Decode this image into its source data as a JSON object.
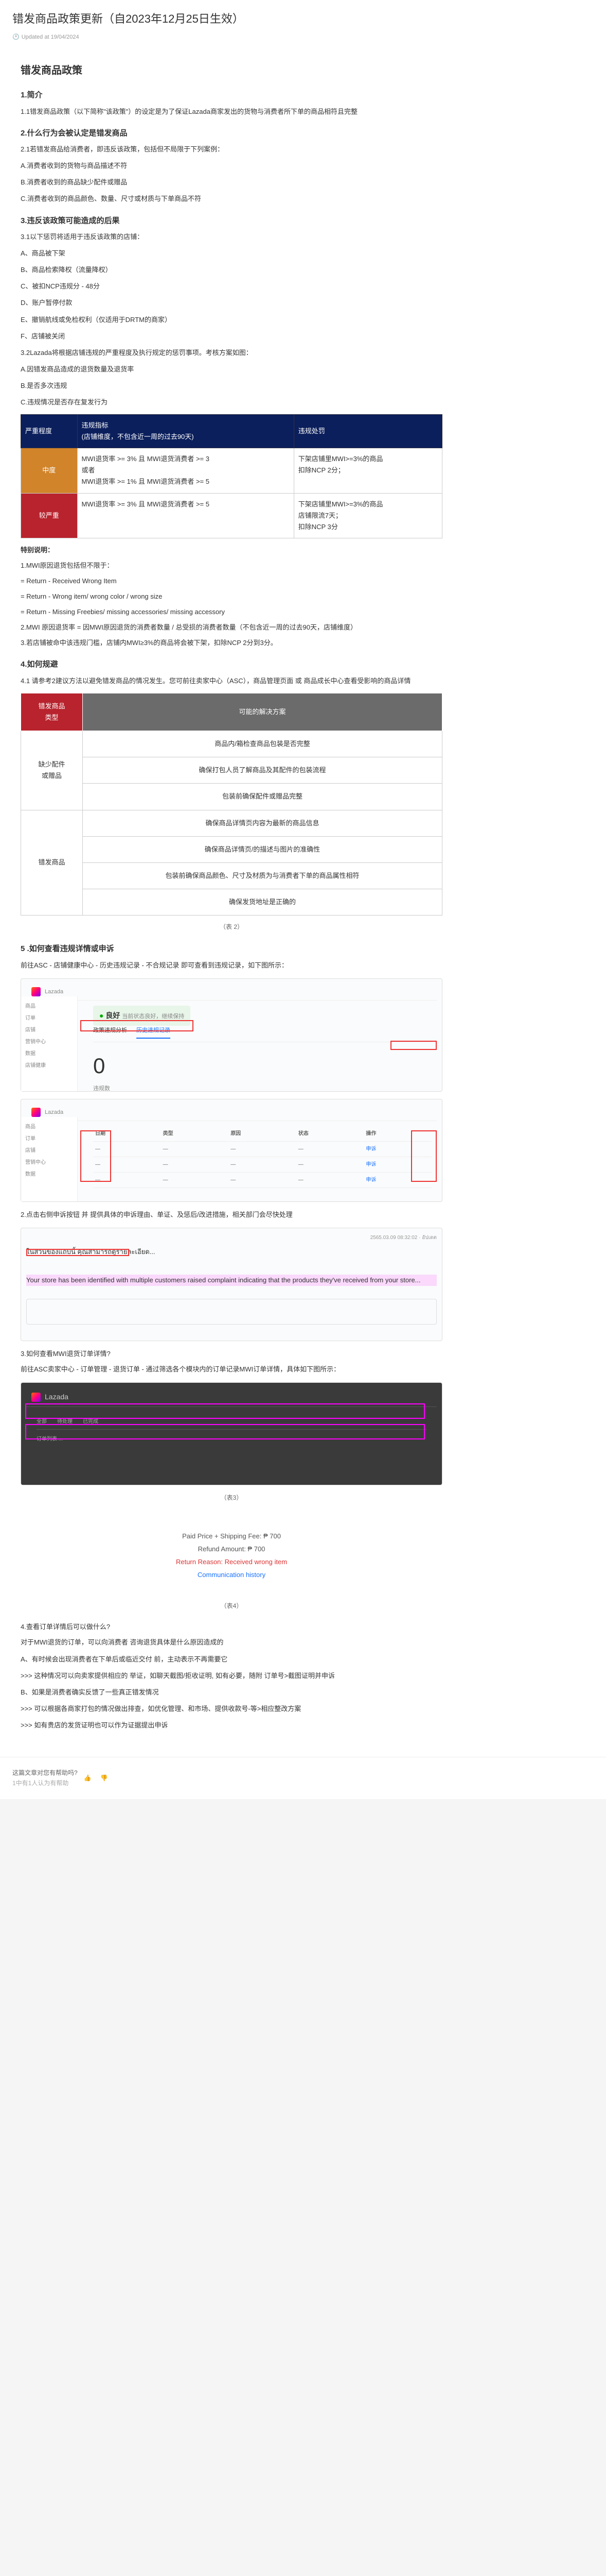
{
  "page_title": "错发商品政策更新（自2023年12月25日生效）",
  "updated_label": "Updated at 19/04/2024",
  "h_policy": "错发商品政策",
  "s1_h": "1.简介",
  "s1_p": "1.1错发商品政策（以下简称\"该政策\"）的设定是为了保证Lazada商家发出的货物与消费者所下单的商品相符且完整",
  "s2_h": "2.什么行为会被认定是错发商品",
  "s2_1": "2.1若错发商品给消费者，即违反该政策，包括但不局限于下列案例：",
  "s2_a": "A.消费者收到的货物与商品描述不符",
  "s2_b": "B.消费者收到的商品缺少配件或赠品",
  "s2_c": "C.消费者收到的商品颜色、数量、尺寸或材质与下单商品不符",
  "s3_h": "3.违反该政策可能造成的后果",
  "s3_1": "3.1以下惩罚将适用于违反该政策的店铺：",
  "s3_a": "A、商品被下架",
  "s3_b": "B、商品检索降权（流量降权）",
  "s3_c": "C、被扣NCP违规分 - 48分",
  "s3_d": "D、账户暂停付款",
  "s3_e": "E、撤销航线或免检权利（仅适用于DRTM的商家）",
  "s3_f": "F、店铺被关闭",
  "s3_2": "3.2Lazada将根据店铺违规的严重程度及执行规定的惩罚事项。考核方案如图：",
  "s3_2a": "A.因错发商品造成的退货数量及退货率",
  "s3_2b": "B.是否多次违规",
  "s3_2c": "C.违规情况是否存在复发行为",
  "t1_h1": "严重程度",
  "t1_h2": "违规指标\n(店铺维度，不包含近一周的过去90天)",
  "t1_h3": "违规处罚",
  "t1_mid": "中度",
  "t1_mid_rule": "MWI退货率 >= 3% 且 MWI退货消费者 >= 3\n或者\nMWI退货率 >= 1% 且 MWI退货消费者 >= 5",
  "t1_mid_pun": "下架店铺里MWI>=3%的商品\n扣除NCP 2分；",
  "t1_high": "较严重",
  "t1_high_rule": "MWI退货率 >= 3% 且 MWI退货消费者 >= 5",
  "t1_high_pun": "下架店铺里MWI>=3%的商品\n店铺限流7天；\n扣除NCP 3分",
  "note_h": "特别说明：",
  "note_1": "1.MWI原因退货包括但不限于：",
  "note_a": "= Return - Received Wrong Item",
  "note_b": "= Return - Wrong item/ wrong color / wrong size",
  "note_c": "= Return - Missing Freebies/ missing accessories/ missing accessory",
  "note_2": "2.MWI 原因退货率 = 因MWI原因退货的消费者数量 / 总受损的消费者数量（不包含近一周的过去90天，店铺维度）",
  "note_3": "3.若店铺被命中该违规门槛，店铺内MWI≥3%的商品将会被下架，扣除NCP 2分到3分。",
  "s4_h": "4.如何规避",
  "s4_1": "4.1 请参考2建议方法以避免错发商品的情况发生。您可前往卖家中心（ASC），商品管理页面 或 商品成长中心查看受影响的商品详情",
  "t2_h1": "错发商品\n类型",
  "t2_h2": "可能的解决方案",
  "t2_r1a": "商品内/箱检查商品包装是否完整",
  "t2_r1h": "缺少配件\n或赠品",
  "t2_r1b": "确保打包人员了解商品及其配件的包装流程",
  "t2_r1c": "包装前确保配件或赠品完整",
  "t2_r2a": "确保商品详情页内容为最新的商品信息",
  "t2_r2h": "错发商品",
  "t2_r2b": "确保商品详情页/的描述与图片的准确性",
  "t2_r2c": "包装前确保商品颜色、尺寸及材质为与消费者下单的商品属性相符",
  "t2_r2d": "确保发货地址是正确的",
  "cap2": "（表 2）",
  "s5_h": "5 .如何查看违规详情或申诉",
  "s5_1": "前往ASC - 店铺健康中心 - 历史违规记录 - 不合规记录 即可查看到违规记录，如下图所示：",
  "dash_title": "良好",
  "dash_tab1": "政策违规分析",
  "dash_tab2": "历史违规记录",
  "dash_0": "0",
  "dash_wk": "违规数",
  "s5_2": "2.点击右侧申诉按钮 并 提供具体的申诉理由、单证、及惩后/改进措施，相关部门会尽快处理",
  "thai_p1": "ในส่วนของแถบนี้ คุณสามารถดูรายละเอียด...",
  "thai_hl": "Your store has been identified with multiple customers raised complaint indicating that the products they've received from your store...",
  "s5_3": "3.如何查看MWI退货订单详情?",
  "s5_3p": "前往ASC卖家中心 - 订单管理 - 退货订单 - 通过筛选各个模块内的订单记录MWI订单详情，具体如下图所示：",
  "cap3": "（表3）",
  "rf_paid": "Paid Price + Shipping Fee: ₱ 700",
  "rf_amt": "Refund Amount: ₱ 700",
  "rf_reason": "Return Reason: Received wrong item",
  "rf_comm": "Communication history",
  "cap4": "（表4）",
  "s5_4": "4.查看订单详情后可以做什么?",
  "s5_4p": "对于MWI退货的订单，可以向消费者 咨询退货具体是什么原因造成的",
  "s5_4a": "A、有时候会出现消费者在下单后或临近交付 前，主动表示不再需要它",
  "s5_4b": ">>> 这种情况可以向卖家提供相应的 举证，如聊天截图/拒收证明, 如有必要，随附 订单号>截图证明并申诉",
  "s5_4c": "B、如果是消费者确实反馈了一些真正错发情况",
  "s5_4d": ">>> 可以根据各商家打包的情况做出排查，如优化管理、和市场、提供收款号-等>相应整改方案",
  "s5_4e": ">>> 如有贵店的发货证明也可以作为证据提出申诉",
  "footer_q": "这篇文章对您有帮助吗?",
  "footer_n": "1中有1人认为有帮助"
}
